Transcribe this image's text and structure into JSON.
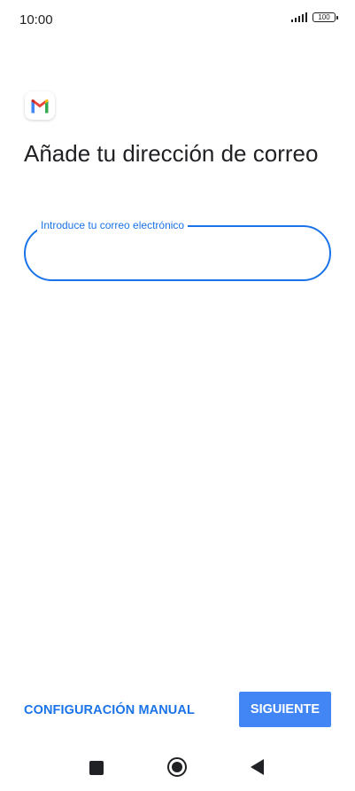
{
  "status_bar": {
    "time": "10:00",
    "battery": "100"
  },
  "app": {
    "logo_icon": "gmail-logo-icon"
  },
  "main": {
    "title": "Añade tu dirección de correo",
    "email_field": {
      "label": "Introduce tu correo electrónico",
      "value": ""
    }
  },
  "actions": {
    "manual_config_label": "CONFIGURACIÓN MANUAL",
    "next_label": "SIGUIENTE"
  },
  "colors": {
    "accent": "#1a73e8",
    "primary_button": "#4285f4",
    "gmail_red": "#ea4335",
    "gmail_blue": "#4285f4",
    "gmail_green": "#34a853",
    "gmail_yellow": "#fbbc04"
  },
  "nav": {
    "recents_icon": "recents-square-icon",
    "home_icon": "home-circle-icon",
    "back_icon": "back-triangle-icon"
  }
}
